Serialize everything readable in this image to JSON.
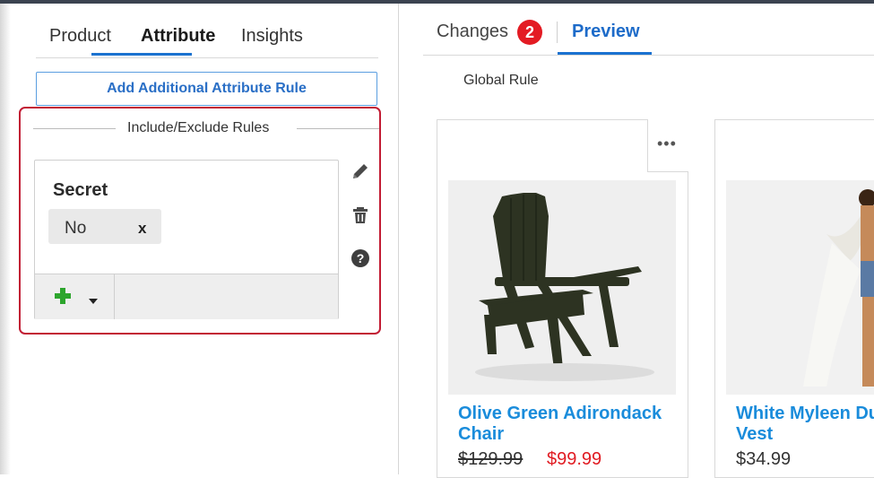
{
  "left_tabs": {
    "product": "Product",
    "attribute": "Attribute",
    "insights": "Insights"
  },
  "add_rule_label": "Add Additional Attribute Rule",
  "include_exclude": {
    "title": "Include/Exclude Rules",
    "rule": {
      "name": "Secret",
      "value": "No",
      "remove": "x"
    },
    "side_icons": [
      "pencil-icon",
      "trash-icon",
      "help-icon"
    ]
  },
  "right_tabs": {
    "changes": "Changes",
    "changes_count": "2",
    "preview": "Preview"
  },
  "global_rule": "Global Rule",
  "products": [
    {
      "title": "Olive Green Adirondack Chair",
      "old_price": "$129.99",
      "price": "$99.99"
    },
    {
      "title": "White Myleen Du",
      "title_line2": "Vest",
      "price": "$34.99"
    }
  ],
  "colors": {
    "accent": "#1b72d0",
    "link": "#1a8cdb",
    "sale": "#e01b22",
    "highlight_border": "#c21c34",
    "add_icon": "#2da52d"
  }
}
